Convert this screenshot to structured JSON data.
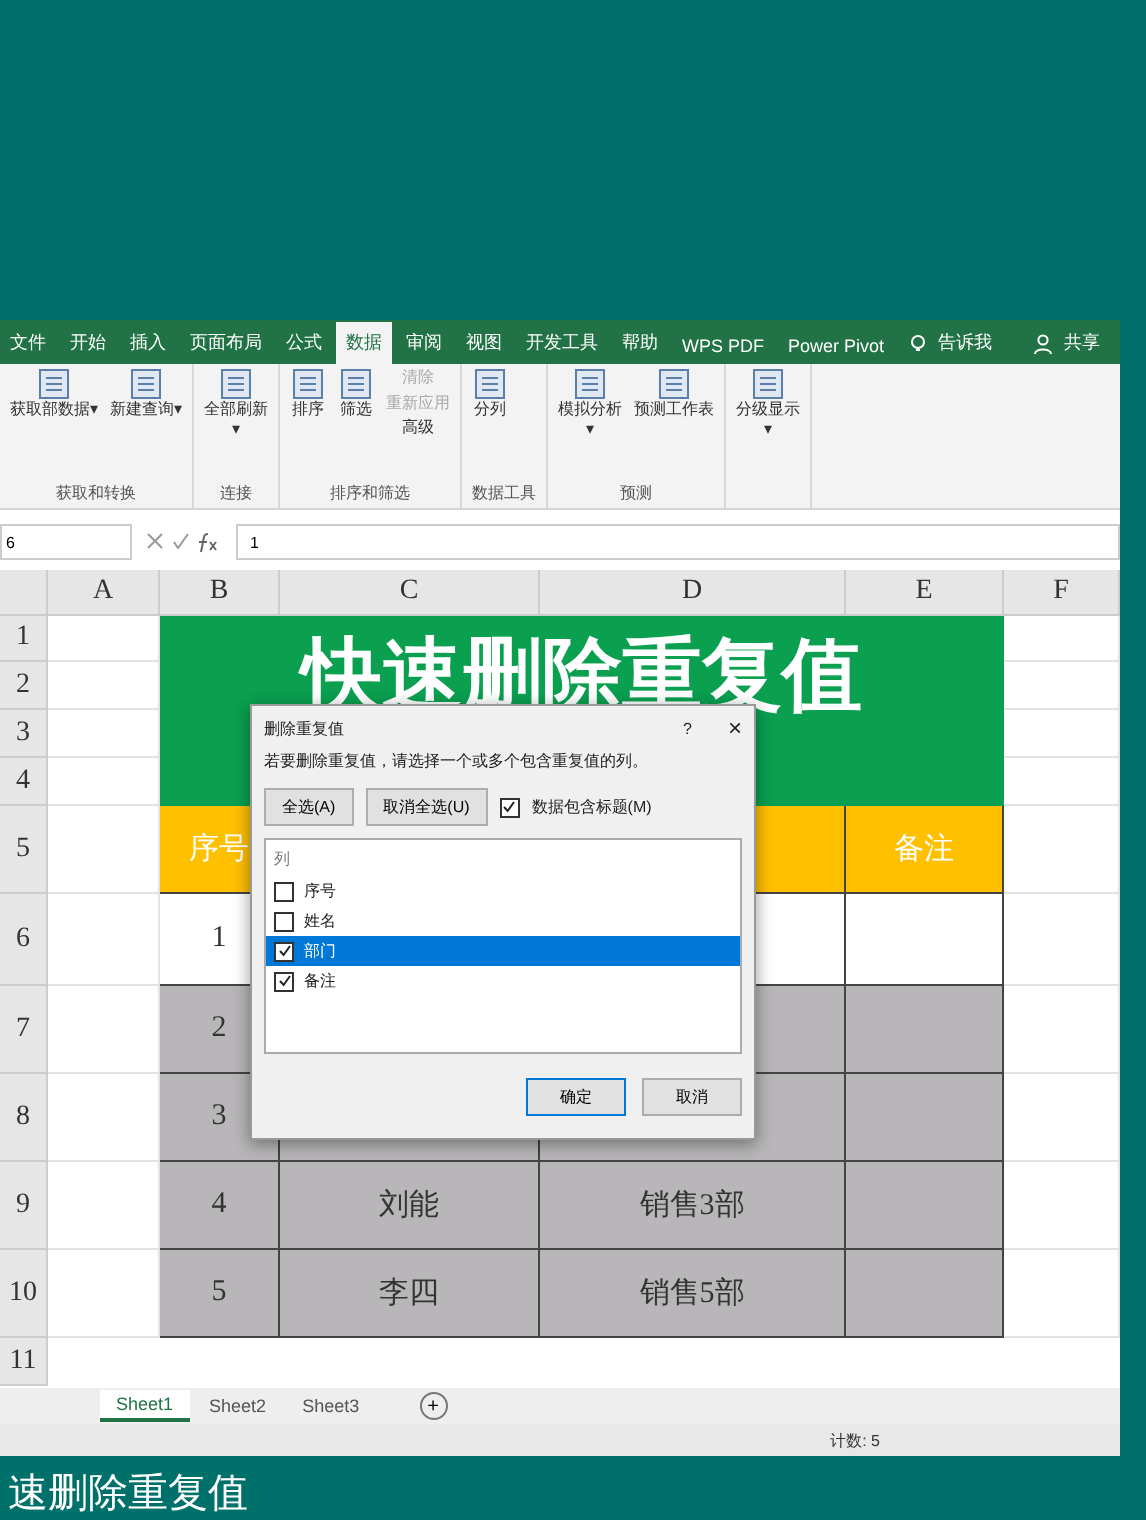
{
  "ribbon_tabs": [
    {
      "label": "文件",
      "selected": false
    },
    {
      "label": "开始",
      "selected": false
    },
    {
      "label": "插入",
      "selected": false
    },
    {
      "label": "页面布局",
      "selected": false
    },
    {
      "label": "公式",
      "selected": false
    },
    {
      "label": "数据",
      "selected": true
    },
    {
      "label": "审阅",
      "selected": false
    },
    {
      "label": "视图",
      "selected": false
    },
    {
      "label": "开发工具",
      "selected": false
    },
    {
      "label": "帮助",
      "selected": false
    },
    {
      "label": "WPS PDF",
      "selected": false
    },
    {
      "label": "Power Pivot",
      "selected": false
    }
  ],
  "tell_me": "告诉我",
  "share": "共享",
  "ribbon_groups": [
    {
      "title": "获取和转换",
      "buttons": [
        {
          "label": "获取部数据▾",
          "disabled": false
        },
        {
          "label": "新建查询▾",
          "disabled": false
        }
      ]
    },
    {
      "title": "连接",
      "buttons": [
        {
          "label": "全部刷新\n▾",
          "disabled": false
        }
      ]
    },
    {
      "title": "排序和筛选",
      "buttons": [
        {
          "label": "排序",
          "disabled": false
        },
        {
          "label": "筛选",
          "disabled": false
        }
      ],
      "small": [
        {
          "label": "清除",
          "disabled": true
        },
        {
          "label": "重新应用",
          "disabled": true
        },
        {
          "label": "高级",
          "disabled": false
        }
      ]
    },
    {
      "title": "数据工具",
      "buttons": [
        {
          "label": "分列",
          "disabled": false
        }
      ]
    },
    {
      "title": "预测",
      "buttons": [
        {
          "label": "模拟分析\n▾",
          "disabled": false
        },
        {
          "label": "预测工作表",
          "disabled": false
        }
      ]
    },
    {
      "buttons": [
        {
          "label": "分级显示\n▾",
          "disabled": false
        }
      ]
    }
  ],
  "formula_bar": {
    "name_box": "6",
    "value": "1"
  },
  "columns": [
    "A",
    "B",
    "C",
    "D",
    "E",
    "F"
  ],
  "row_numbers": [
    "1",
    "2",
    "3",
    "4",
    "5",
    "6",
    "7",
    "8",
    "9",
    "10",
    "11"
  ],
  "sheet_title": "快速删除重复值",
  "header_row": {
    "first": "序号",
    "last": "备注"
  },
  "data_rows": [
    [
      "1",
      null,
      null,
      null
    ],
    [
      "2",
      null,
      null,
      null
    ],
    [
      "3",
      null,
      null,
      null
    ],
    [
      "4",
      "刘能",
      "销售3部",
      null
    ],
    [
      "5",
      "李四",
      "销售5部",
      null
    ]
  ],
  "dialog": {
    "title": "删除重复值",
    "help": "?",
    "close": "×",
    "instruction": "若要删除重复值，请选择一个或多个包含重复值的列。",
    "select_all": "全选(A)",
    "unselect_all": "取消全选(U)",
    "has_headers": {
      "label": "数据包含标题(M)",
      "checked": true
    },
    "list_header": "列",
    "items": [
      {
        "label": "序号",
        "checked": false,
        "selected": false
      },
      {
        "label": "姓名",
        "checked": false,
        "selected": false
      },
      {
        "label": "部门",
        "checked": true,
        "selected": true
      },
      {
        "label": "备注",
        "checked": true,
        "selected": false
      }
    ],
    "ok": "确定",
    "cancel": "取消"
  },
  "sheet_tabs": [
    {
      "label": "Sheet1",
      "selected": true
    },
    {
      "label": "Sheet2",
      "selected": false
    },
    {
      "label": "Sheet3",
      "selected": false
    }
  ],
  "add_sheet": "+",
  "status": "计数: 5",
  "caption": "速删除重复值"
}
